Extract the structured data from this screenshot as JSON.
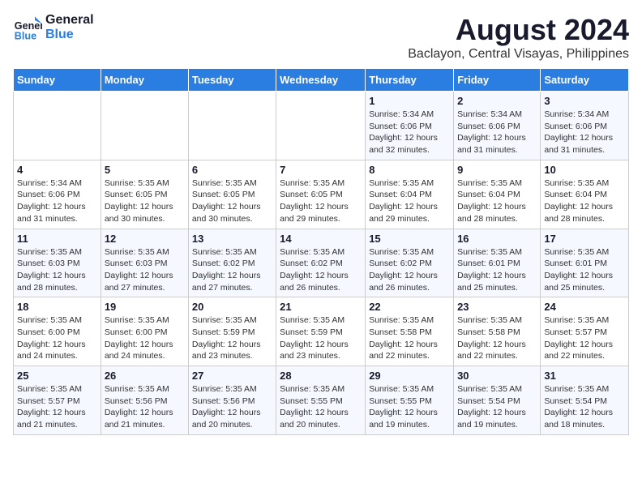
{
  "logo": {
    "line1": "General",
    "line2": "Blue"
  },
  "title": "August 2024",
  "subtitle": "Baclayon, Central Visayas, Philippines",
  "days_of_week": [
    "Sunday",
    "Monday",
    "Tuesday",
    "Wednesday",
    "Thursday",
    "Friday",
    "Saturday"
  ],
  "weeks": [
    [
      {
        "day": "",
        "info": ""
      },
      {
        "day": "",
        "info": ""
      },
      {
        "day": "",
        "info": ""
      },
      {
        "day": "",
        "info": ""
      },
      {
        "day": "1",
        "info": "Sunrise: 5:34 AM\nSunset: 6:06 PM\nDaylight: 12 hours\nand 32 minutes."
      },
      {
        "day": "2",
        "info": "Sunrise: 5:34 AM\nSunset: 6:06 PM\nDaylight: 12 hours\nand 31 minutes."
      },
      {
        "day": "3",
        "info": "Sunrise: 5:34 AM\nSunset: 6:06 PM\nDaylight: 12 hours\nand 31 minutes."
      }
    ],
    [
      {
        "day": "4",
        "info": "Sunrise: 5:34 AM\nSunset: 6:06 PM\nDaylight: 12 hours\nand 31 minutes."
      },
      {
        "day": "5",
        "info": "Sunrise: 5:35 AM\nSunset: 6:05 PM\nDaylight: 12 hours\nand 30 minutes."
      },
      {
        "day": "6",
        "info": "Sunrise: 5:35 AM\nSunset: 6:05 PM\nDaylight: 12 hours\nand 30 minutes."
      },
      {
        "day": "7",
        "info": "Sunrise: 5:35 AM\nSunset: 6:05 PM\nDaylight: 12 hours\nand 29 minutes."
      },
      {
        "day": "8",
        "info": "Sunrise: 5:35 AM\nSunset: 6:04 PM\nDaylight: 12 hours\nand 29 minutes."
      },
      {
        "day": "9",
        "info": "Sunrise: 5:35 AM\nSunset: 6:04 PM\nDaylight: 12 hours\nand 28 minutes."
      },
      {
        "day": "10",
        "info": "Sunrise: 5:35 AM\nSunset: 6:04 PM\nDaylight: 12 hours\nand 28 minutes."
      }
    ],
    [
      {
        "day": "11",
        "info": "Sunrise: 5:35 AM\nSunset: 6:03 PM\nDaylight: 12 hours\nand 28 minutes."
      },
      {
        "day": "12",
        "info": "Sunrise: 5:35 AM\nSunset: 6:03 PM\nDaylight: 12 hours\nand 27 minutes."
      },
      {
        "day": "13",
        "info": "Sunrise: 5:35 AM\nSunset: 6:02 PM\nDaylight: 12 hours\nand 27 minutes."
      },
      {
        "day": "14",
        "info": "Sunrise: 5:35 AM\nSunset: 6:02 PM\nDaylight: 12 hours\nand 26 minutes."
      },
      {
        "day": "15",
        "info": "Sunrise: 5:35 AM\nSunset: 6:02 PM\nDaylight: 12 hours\nand 26 minutes."
      },
      {
        "day": "16",
        "info": "Sunrise: 5:35 AM\nSunset: 6:01 PM\nDaylight: 12 hours\nand 25 minutes."
      },
      {
        "day": "17",
        "info": "Sunrise: 5:35 AM\nSunset: 6:01 PM\nDaylight: 12 hours\nand 25 minutes."
      }
    ],
    [
      {
        "day": "18",
        "info": "Sunrise: 5:35 AM\nSunset: 6:00 PM\nDaylight: 12 hours\nand 24 minutes."
      },
      {
        "day": "19",
        "info": "Sunrise: 5:35 AM\nSunset: 6:00 PM\nDaylight: 12 hours\nand 24 minutes."
      },
      {
        "day": "20",
        "info": "Sunrise: 5:35 AM\nSunset: 5:59 PM\nDaylight: 12 hours\nand 23 minutes."
      },
      {
        "day": "21",
        "info": "Sunrise: 5:35 AM\nSunset: 5:59 PM\nDaylight: 12 hours\nand 23 minutes."
      },
      {
        "day": "22",
        "info": "Sunrise: 5:35 AM\nSunset: 5:58 PM\nDaylight: 12 hours\nand 22 minutes."
      },
      {
        "day": "23",
        "info": "Sunrise: 5:35 AM\nSunset: 5:58 PM\nDaylight: 12 hours\nand 22 minutes."
      },
      {
        "day": "24",
        "info": "Sunrise: 5:35 AM\nSunset: 5:57 PM\nDaylight: 12 hours\nand 22 minutes."
      }
    ],
    [
      {
        "day": "25",
        "info": "Sunrise: 5:35 AM\nSunset: 5:57 PM\nDaylight: 12 hours\nand 21 minutes."
      },
      {
        "day": "26",
        "info": "Sunrise: 5:35 AM\nSunset: 5:56 PM\nDaylight: 12 hours\nand 21 minutes."
      },
      {
        "day": "27",
        "info": "Sunrise: 5:35 AM\nSunset: 5:56 PM\nDaylight: 12 hours\nand 20 minutes."
      },
      {
        "day": "28",
        "info": "Sunrise: 5:35 AM\nSunset: 5:55 PM\nDaylight: 12 hours\nand 20 minutes."
      },
      {
        "day": "29",
        "info": "Sunrise: 5:35 AM\nSunset: 5:55 PM\nDaylight: 12 hours\nand 19 minutes."
      },
      {
        "day": "30",
        "info": "Sunrise: 5:35 AM\nSunset: 5:54 PM\nDaylight: 12 hours\nand 19 minutes."
      },
      {
        "day": "31",
        "info": "Sunrise: 5:35 AM\nSunset: 5:54 PM\nDaylight: 12 hours\nand 18 minutes."
      }
    ]
  ]
}
